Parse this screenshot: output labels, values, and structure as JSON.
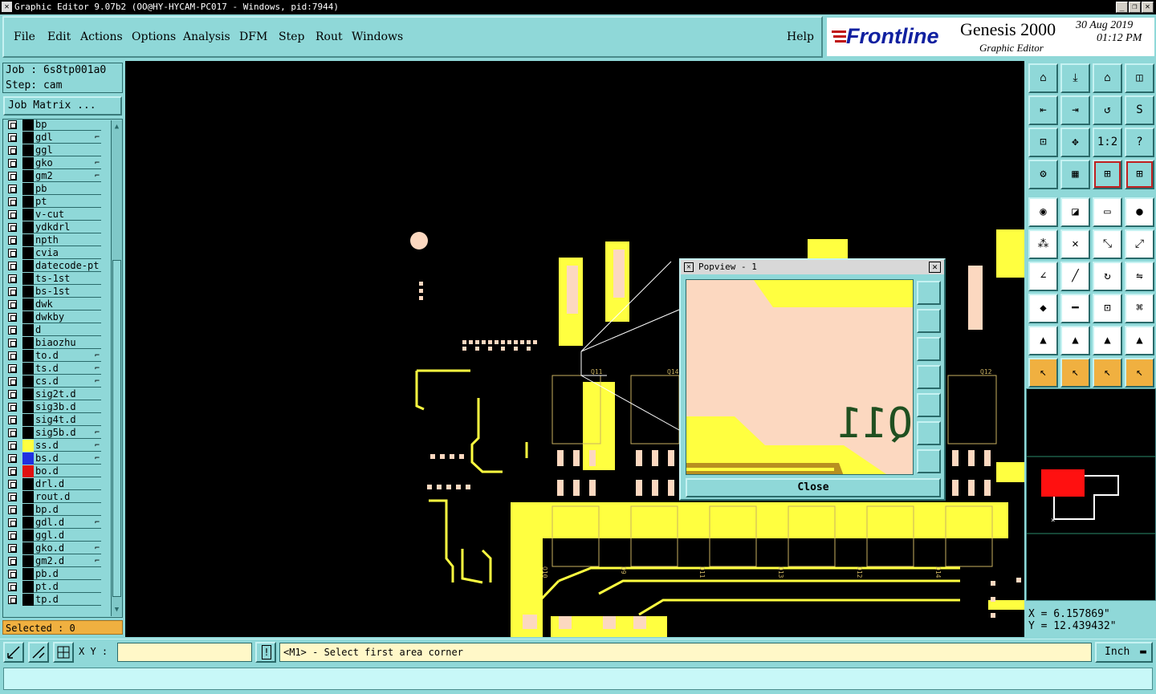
{
  "window": {
    "title": "Graphic Editor 9.07b2 (OO@HY-HYCAM-PC017 - Windows, pid:7944)"
  },
  "menu": [
    "File",
    "Edit",
    "Actions",
    "Options",
    "Analysis",
    "DFM",
    "Step",
    "Rout",
    "Windows"
  ],
  "help": "Help",
  "brand": {
    "logo": "Frontline",
    "product": "Genesis 2000",
    "subtitle": "Graphic Editor",
    "date": "30 Aug 2019",
    "time": "01:12 PM"
  },
  "job": {
    "job_label": "Job : 6s8tp001a0",
    "step_label": "Step: cam",
    "matrix_button": "Job Matrix ..."
  },
  "layers": [
    {
      "name": "bp",
      "mark": "",
      "color": ""
    },
    {
      "name": "gdl",
      "mark": "⌐",
      "color": ""
    },
    {
      "name": "ggl",
      "mark": "",
      "color": ""
    },
    {
      "name": "gko",
      "mark": "⌐",
      "color": ""
    },
    {
      "name": "gm2",
      "mark": "⌐",
      "color": ""
    },
    {
      "name": "pb",
      "mark": "",
      "color": ""
    },
    {
      "name": "pt",
      "mark": "",
      "color": ""
    },
    {
      "name": "v-cut",
      "mark": "",
      "color": ""
    },
    {
      "name": "ydkdrl",
      "mark": "",
      "color": ""
    },
    {
      "name": "npth",
      "mark": "",
      "color": ""
    },
    {
      "name": "cvia",
      "mark": "",
      "color": ""
    },
    {
      "name": "datecode-pt",
      "mark": "",
      "color": ""
    },
    {
      "name": "ts-1st",
      "mark": "",
      "color": ""
    },
    {
      "name": "bs-1st",
      "mark": "",
      "color": ""
    },
    {
      "name": "dwk",
      "mark": "",
      "color": ""
    },
    {
      "name": "dwkby",
      "mark": "",
      "color": ""
    },
    {
      "name": "d",
      "mark": "",
      "color": ""
    },
    {
      "name": "biaozhu",
      "mark": "",
      "color": ""
    },
    {
      "name": "to.d",
      "mark": "⌐",
      "color": ""
    },
    {
      "name": "ts.d",
      "mark": "⌐",
      "color": ""
    },
    {
      "name": "cs.d",
      "mark": "⌐",
      "color": ""
    },
    {
      "name": "sig2t.d",
      "mark": "",
      "color": ""
    },
    {
      "name": "sig3b.d",
      "mark": "",
      "color": ""
    },
    {
      "name": "sig4t.d",
      "mark": "",
      "color": ""
    },
    {
      "name": "sig5b.d",
      "mark": "⌐",
      "color": ""
    },
    {
      "name": "ss.d",
      "mark": "⌐",
      "color": "#ffff40"
    },
    {
      "name": "bs.d",
      "mark": "⌐",
      "color": "#2030e0"
    },
    {
      "name": "bo.d",
      "mark": "",
      "color": "#e01010"
    },
    {
      "name": "drl.d",
      "mark": "",
      "color": ""
    },
    {
      "name": "rout.d",
      "mark": "",
      "color": ""
    },
    {
      "name": "bp.d",
      "mark": "",
      "color": ""
    },
    {
      "name": "gdl.d",
      "mark": "⌐",
      "color": ""
    },
    {
      "name": "ggl.d",
      "mark": "",
      "color": ""
    },
    {
      "name": "gko.d",
      "mark": "⌐",
      "color": ""
    },
    {
      "name": "gm2.d",
      "mark": "⌐",
      "color": ""
    },
    {
      "name": "pb.d",
      "mark": "",
      "color": ""
    },
    {
      "name": "pt.d",
      "mark": "",
      "color": ""
    },
    {
      "name": "tp.d",
      "mark": "",
      "color": ""
    }
  ],
  "selected": "Selected : 0",
  "coords": {
    "x": "X = 6.157869\"",
    "y": "Y = 12.439432\""
  },
  "popview": {
    "title": "Popview - 1",
    "close": "Close",
    "zoom_text": "Q11"
  },
  "bottom": {
    "xy_label": "X Y :",
    "prompt": "<M1> - Select first area corner",
    "unit": "Inch",
    "info": "!"
  },
  "board_labels": [
    "Q11",
    "Q14",
    "Q12",
    "Q10",
    "Q9",
    "Q11",
    "Q13",
    "Q12",
    "Q14",
    "1:2",
    "?"
  ],
  "colors": {
    "bg_panel": "#8fd8d8",
    "board_copper": "#ffff40",
    "pad": "#fcd8c0",
    "selected": "#f0b040"
  }
}
